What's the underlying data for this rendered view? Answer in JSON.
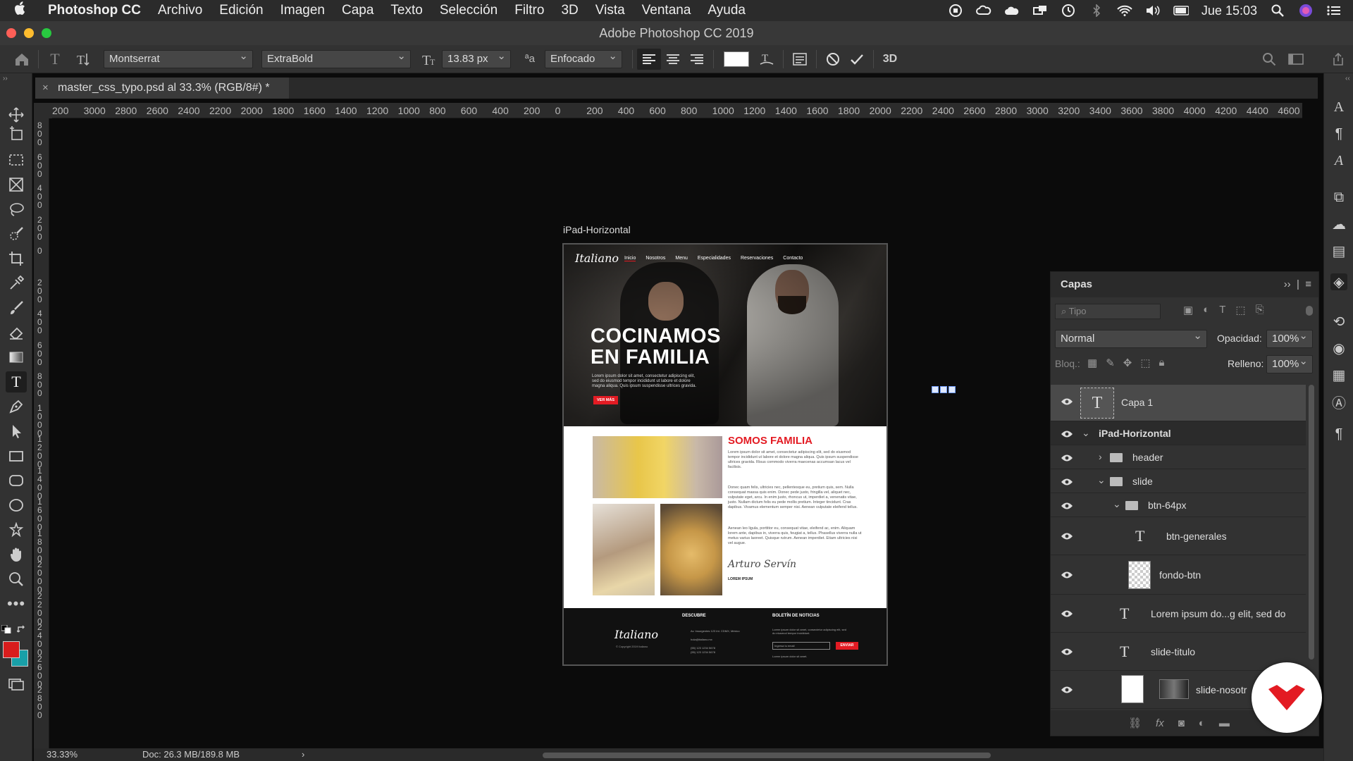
{
  "menubar": {
    "apple_icon": "apple-icon",
    "items": [
      "Photoshop CC",
      "Archivo",
      "Edición",
      "Imagen",
      "Capa",
      "Texto",
      "Selección",
      "Filtro",
      "3D",
      "Vista",
      "Ventana",
      "Ayuda"
    ],
    "clock": "Jue 15:03"
  },
  "window": {
    "title": "Adobe Photoshop CC 2019"
  },
  "options": {
    "font_family": "Montserrat",
    "font_style": "ExtraBold",
    "font_size": "13.83 px",
    "aa_label": "ªa",
    "antialias": "Enfocado",
    "text_color": "#ffffff"
  },
  "document_tab": {
    "label": "master_css_typo.psd al 33.3% (RGB/8#) *",
    "close": "×"
  },
  "rulers": {
    "horizontal": [
      "200",
      "3000",
      "2800",
      "2600",
      "2400",
      "2200",
      "2000",
      "1800",
      "1600",
      "1400",
      "1200",
      "1000",
      "800",
      "600",
      "400",
      "200",
      "0",
      "200",
      "400",
      "600",
      "800",
      "1000",
      "1200",
      "1400",
      "1600",
      "1800",
      "2000",
      "2200",
      "2400",
      "2600",
      "2800",
      "3000",
      "3200",
      "3400",
      "3600",
      "3800",
      "4000",
      "4200",
      "4400",
      "4600"
    ],
    "vertical": [
      "800",
      "600",
      "400",
      "200",
      "0",
      "200",
      "400",
      "600",
      "800",
      "1000",
      "1200",
      "1400",
      "1600",
      "1800",
      "2000",
      "2200",
      "2400",
      "2600",
      "2800"
    ]
  },
  "artboard": {
    "label": "iPad-Horizontal",
    "hero": {
      "logo": "Italiano",
      "nav": [
        "Inicio",
        "Nosotros",
        "Menu",
        "Especialidades",
        "Reservaciones",
        "Contacto"
      ],
      "title_line1": "COCINAMOS",
      "title_line2": "EN FAMILIA",
      "lorem": "Lorem ipsum dolor sit amet, consectetur adipiscing elit, sed do eiusmod tempor incididunt ut labore et dolore magna aliqua. Quis ipsum suspendisse ultrices gravida.",
      "button": "VER MÁS"
    },
    "about": {
      "heading": "SOMOS FAMILIA",
      "p1": "Lorem ipsum dolor sit amet, consectetur adipiscing elit, sed do eiusmod tempor incididunt ut labore et dolore magna aliqua. Quis ipsum suspendisse ultrices gravida. Risus commodo viverra maecenas accumsan lacus vel facilisis.",
      "p2": "Donec quam felis, ultricies nec, pellentesque eu, pretium quis, sem. Nulla consequat massa quis enim. Donec pede justo, fringilla vel, aliquet nec, vulputate eget, arcu. In enim justo, rhoncus ut, imperdiet a, venenatis vitae, justo. Nullam dictum felis eu pede mollis pretium. Integer tincidunt. Cras dapibus. Vivamus elementum semper nisi. Aenean vulputate eleifend tellus.",
      "p3": "Aenean leo ligula, porttitor eu, consequat vitae, eleifend ac, enim. Aliquam lorem ante, dapibus in, viverra quis, feugiat a, tellus. Phasellus viverra nulla ut metus varius laoreet. Quisque rutrum. Aenean imperdiet. Etiam ultricies nisi vel augue.",
      "signature": "Arturo Servín",
      "sig_sub": "LOREM IPSUM"
    },
    "footer": {
      "logo": "Italiano",
      "copy": "© Copyright 2019 Italiano",
      "col1_heading": "DESCUBRE",
      "col1_lines": [
        "Av. Insurgentes 123 Int. CDMX, México",
        "hola@italiano.mx",
        "(55) 123 1234 5678",
        "(55) 123 1234 5678"
      ],
      "col2_heading": "BOLETÍN DE NOTICIAS",
      "col2_text": "Lorem ipsum dolor sit amet, consectetur adipiscing elit, sed do eiusmod tempor incididunt.",
      "email_placeholder": "Ingresa tu email",
      "send": "ENVIAR",
      "legal": "Lorem ipsum dolor sit amet."
    }
  },
  "layers_panel": {
    "title": "Capas",
    "search_placeholder": "Tipo",
    "blend_mode": "Normal",
    "opacity_label": "Opacidad:",
    "opacity": "100%",
    "lock_label": "Bloq.:",
    "fill_label": "Relleno:",
    "fill": "100%",
    "layers": [
      {
        "name": "Capa 1",
        "kind": "text",
        "selected": true
      },
      {
        "name": "iPad-Horizontal",
        "kind": "artboard"
      },
      {
        "name": "header",
        "kind": "folder"
      },
      {
        "name": "slide",
        "kind": "folder"
      },
      {
        "name": "btn-64px",
        "kind": "folder"
      },
      {
        "name": "btn-generales",
        "kind": "text"
      },
      {
        "name": "fondo-btn",
        "kind": "shape"
      },
      {
        "name": "Lorem ipsum do...g elit, sed do",
        "kind": "text"
      },
      {
        "name": "slide-titulo",
        "kind": "text"
      },
      {
        "name": "slide-nosotr",
        "kind": "image"
      }
    ]
  },
  "status": {
    "zoom": "33.33%",
    "doc": "Doc: 26.3 MB/189.8 MB",
    "arrow": "›"
  },
  "colors": {
    "foreground": "#d81c1c",
    "background": "#19a0a8",
    "accent_red": "#e31b23"
  }
}
